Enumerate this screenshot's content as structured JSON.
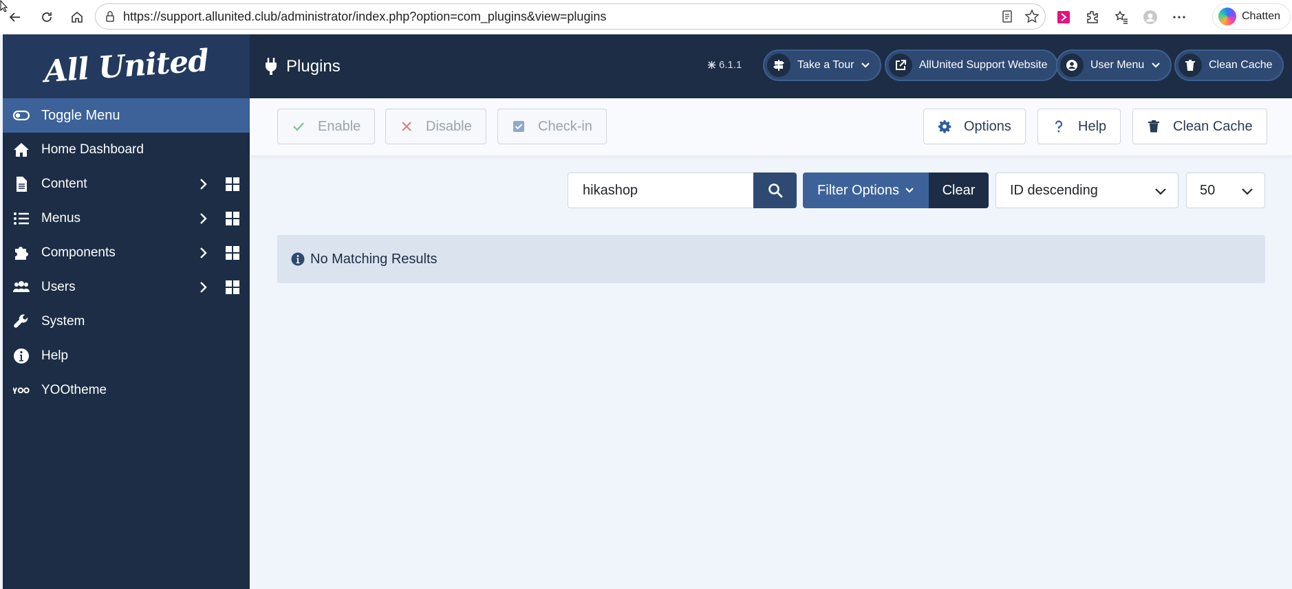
{
  "browser": {
    "url": "https://support.allunited.club/administrator/index.php?option=com_plugins&view=plugins",
    "copilot_label": "Chatten"
  },
  "header": {
    "brand": "All United",
    "title": "Plugins",
    "version": "6.1.1",
    "buttons": {
      "tour": "Take a Tour",
      "support": "AllUnited Support Website",
      "user_menu": "User Menu",
      "clean_cache": "Clean Cache"
    }
  },
  "sidebar": {
    "toggle": "Toggle Menu",
    "items": [
      {
        "label": "Home Dashboard"
      },
      {
        "label": "Content"
      },
      {
        "label": "Menus"
      },
      {
        "label": "Components"
      },
      {
        "label": "Users"
      },
      {
        "label": "System"
      },
      {
        "label": "Help"
      },
      {
        "label": "YOOtheme"
      }
    ]
  },
  "toolbar": {
    "enable": "Enable",
    "disable": "Disable",
    "checkin": "Check-in",
    "options": "Options",
    "help": "Help",
    "clean_cache": "Clean Cache"
  },
  "filters": {
    "search_value": "hikashop",
    "filter_options": "Filter Options",
    "clear": "Clear",
    "ordering": "ID descending",
    "limit": "50"
  },
  "alert": {
    "message": "No Matching Results"
  },
  "colors": {
    "header_bg": "#1c2d45",
    "accent": "#3c6299",
    "page_bg": "#f0f4fb"
  }
}
